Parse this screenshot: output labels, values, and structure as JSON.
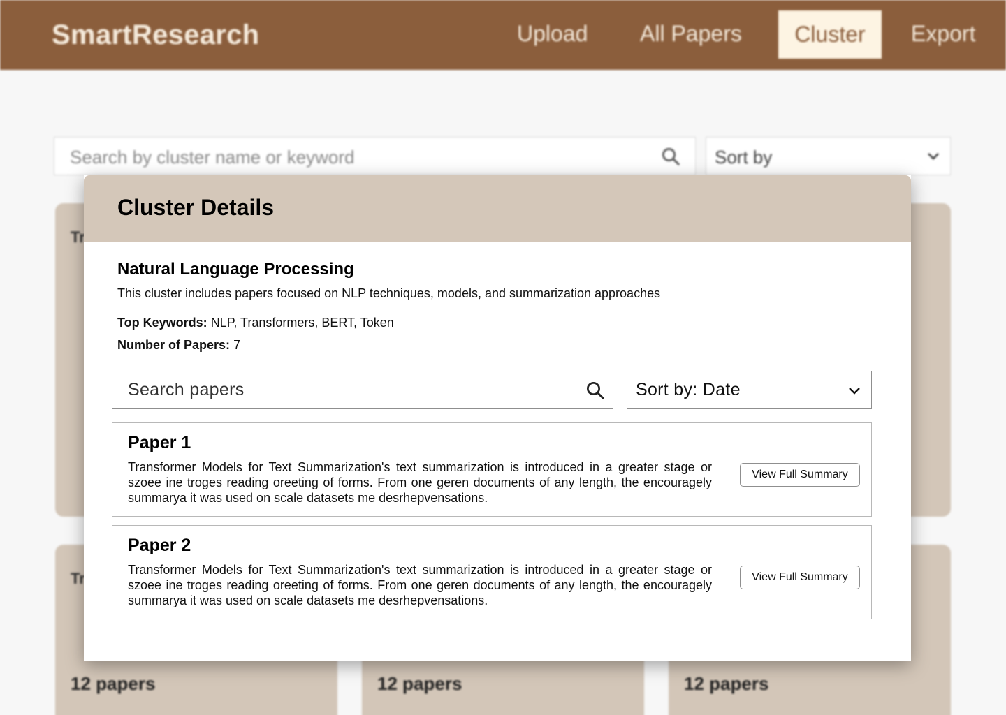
{
  "header": {
    "brand": "SmartResearch",
    "nav": [
      "Upload",
      "All Papers",
      "Cluster",
      "Export"
    ],
    "active_nav": "Cluster"
  },
  "filters": {
    "search_placeholder": "Search by cluster name or keyword",
    "sort_label": "Sort by"
  },
  "background_cards": {
    "title_fragment": "Tr",
    "count_label": "12 papers"
  },
  "modal": {
    "title": "Cluster Details",
    "cluster_name": "Natural Language Processing",
    "description": "This cluster includes papers focused on NLP techniques, models, and summarization approaches",
    "keywords_label": "Top Keywords:",
    "keywords": "NLP, Transformers, BERT, Token",
    "count_label": "Number of Papers:",
    "count": "7",
    "search_placeholder": "Search papers",
    "sort_label": "Sort by: Date",
    "papers": [
      {
        "title": "Paper 1",
        "summary": "Transformer Models for Text Summarization's text summarization is introduced in a greater stage or szoee ine troges reading oreeting of forms. From one geren documents of any length, the encouragely summarya it was used on scale datasets me desrhepvensations.",
        "button": "View Full Summary"
      },
      {
        "title": "Paper 2",
        "summary": "Transformer Models for Text Summarization's text summarization is introduced in a greater stage or szoee ine troges reading oreeting of forms. From one geren documents of any length, the encouragely summarya it was used on scale datasets me desrhepvensations.",
        "button": "View Full Summary"
      }
    ]
  },
  "colors": {
    "header_bg": "#8b5e3c",
    "active_tab_bg": "#fdf4e3",
    "card_bg": "#d3c6b8",
    "modal_header_bg": "#d4c7b9"
  }
}
